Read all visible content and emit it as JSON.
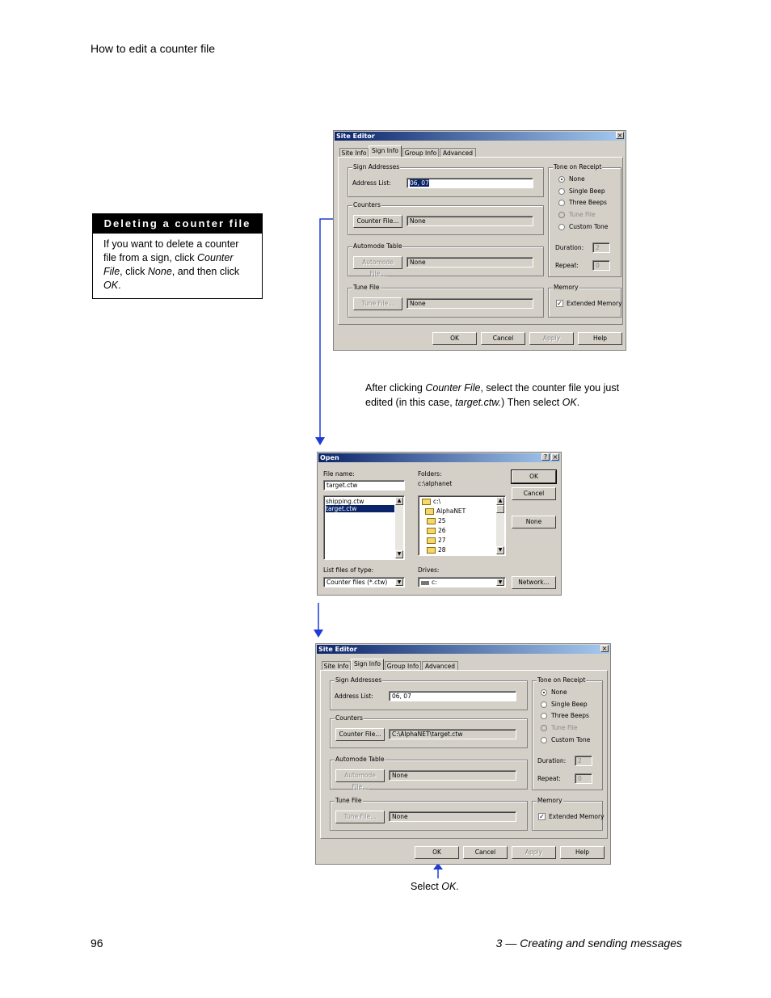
{
  "page": {
    "header": "How to edit a counter file",
    "page_number": "96",
    "chapter": "3 — Creating and sending messages"
  },
  "sidebar": {
    "title": "Deleting a counter file",
    "body_1": "If you want to delete a counter file from a sign, click ",
    "body_2": "Counter File",
    "body_3": ", click ",
    "body_4": "None",
    "body_5": ", and then click ",
    "body_6": "OK",
    "body_7": "."
  },
  "caption1": {
    "p1": "After clicking ",
    "p2": "Counter File",
    "p3": ", select the counter file you just edited (in this case, ",
    "p4": "target.ctw.",
    "p5": ") Then select ",
    "p6": "OK",
    "p7": "."
  },
  "caption2": {
    "p1": "Select ",
    "p2": "OK",
    "p3": "."
  },
  "site_editor": {
    "title": "Site Editor",
    "close": "×",
    "tabs": [
      "Site Info",
      "Sign Info",
      "Group Info",
      "Advanced"
    ],
    "sign_addresses": "Sign Addresses",
    "address_list_label": "Address List:",
    "address_list_value": "06, 07",
    "counters": "Counters",
    "counter_file_btn": "Counter File...",
    "counter_value_before": "None",
    "counter_value_after": "C:\\AlphaNET\\target.ctw",
    "automode_table": "Automode Table",
    "automode_btn": "Automode File...",
    "automode_value": "None",
    "tune_file": "Tune File",
    "tune_btn": "Tune File...",
    "tune_value": "None",
    "tone_on_receipt": "Tone on Receipt",
    "tone_options": [
      "None",
      "Single Beep",
      "Three Beeps",
      "Tune File",
      "Custom Tone"
    ],
    "duration_label": "Duration:",
    "duration_value": "2",
    "repeat_label": "Repeat:",
    "repeat_value": "0",
    "memory": "Memory",
    "extended_memory": "Extended Memory",
    "ok": "OK",
    "cancel": "Cancel",
    "apply": "Apply",
    "help": "Help"
  },
  "open_dialog": {
    "title": "Open",
    "help_btn": "?",
    "close": "×",
    "file_name_label": "File name:",
    "file_name_value": "target.ctw",
    "files": [
      "shipping.ctw",
      "target.ctw"
    ],
    "folders_label": "Folders:",
    "folder_path": "c:\\alphanet",
    "folder_items": [
      "c:\\",
      "AlphaNET",
      "25",
      "26",
      "27",
      "28"
    ],
    "ok": "OK",
    "cancel": "Cancel",
    "none": "None",
    "list_type_label": "List files of type:",
    "list_type_value": "Counter files (*.ctw)",
    "drives_label": "Drives:",
    "drives_value": "c:",
    "network": "Network..."
  }
}
